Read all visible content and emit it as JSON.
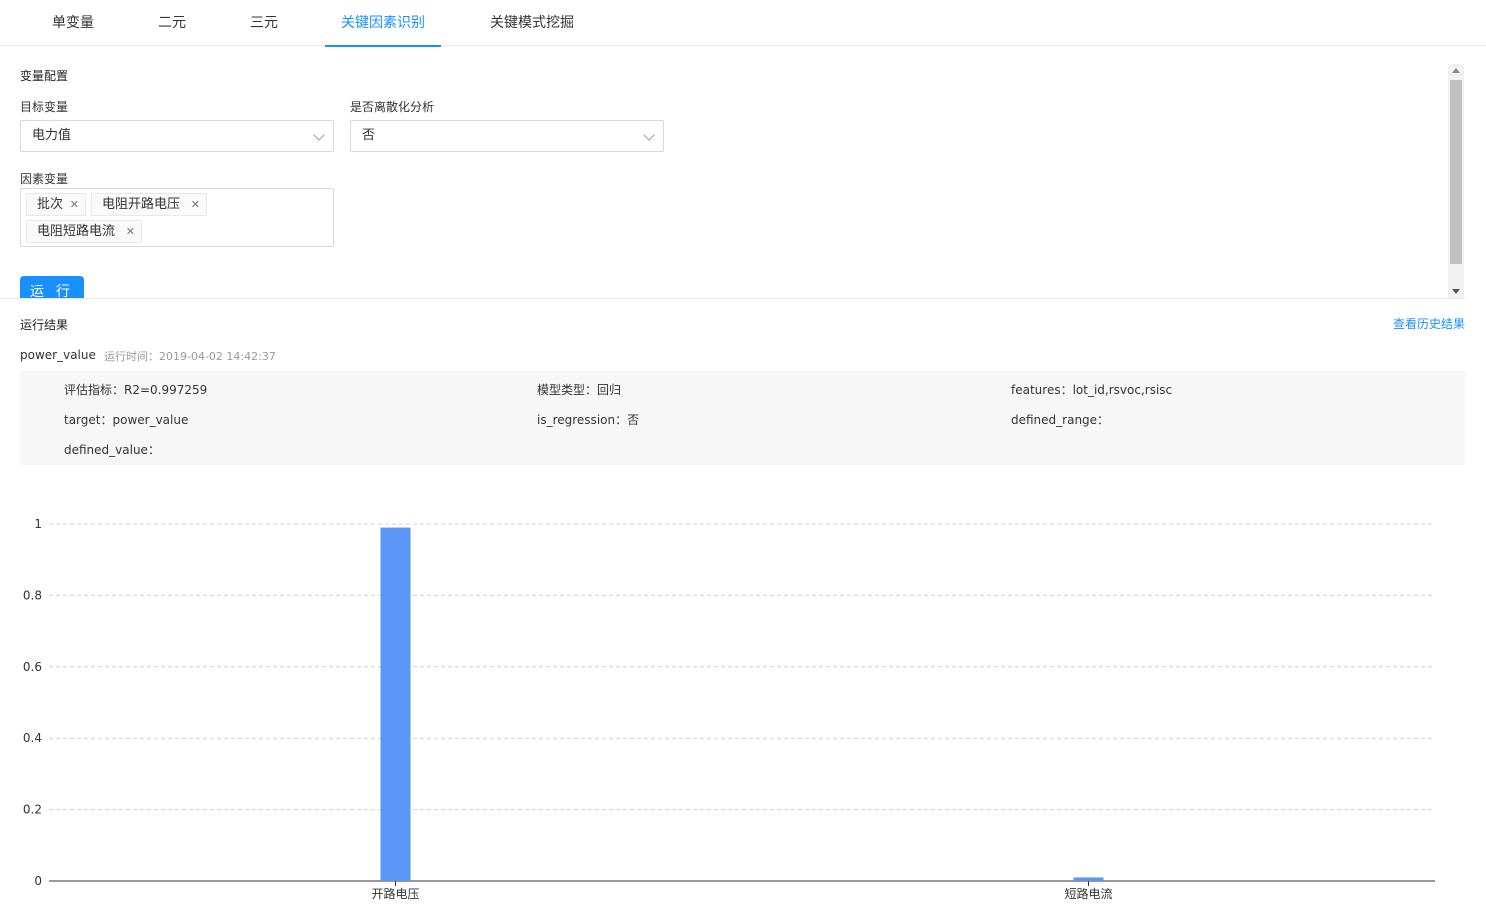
{
  "tabs": [
    {
      "label": "单变量",
      "active": false
    },
    {
      "label": "二元",
      "active": false
    },
    {
      "label": "三元",
      "active": false
    },
    {
      "label": "关键因素识别",
      "active": true
    },
    {
      "label": "关键模式挖掘",
      "active": false
    }
  ],
  "config": {
    "title": "变量配置",
    "target_label": "目标变量",
    "target_value": "电力值",
    "discretize_label": "是否离散化分析",
    "discretize_value": "否",
    "factors_label": "因素变量",
    "factors": [
      "批次",
      "电阻开路电压",
      "电阻短路电流"
    ],
    "run_label": "运 行"
  },
  "result": {
    "title": "运行结果",
    "history_link": "查看历史结果",
    "target_name": "power_value",
    "run_time_label": "运行时间：",
    "run_time_value": "2019-04-02 14:42:37",
    "metrics": [
      "评估指标：R2=0.997259",
      "模型类型：回归",
      "features：lot_id,rsvoc,rsisc",
      "target：power_value",
      "is_regression：否",
      "defined_range：",
      "defined_value："
    ]
  },
  "colors": {
    "accent": "#1890ff",
    "bar": "#5b96f7"
  },
  "chart_data": {
    "type": "bar",
    "categories": [
      "开路电压",
      "短路电流"
    ],
    "values": [
      0.99,
      0.01
    ],
    "ylim": [
      0,
      1
    ],
    "yticks": [
      "0",
      "0.2",
      "0.4",
      "0.6",
      "0.8",
      "1"
    ],
    "grid": true
  }
}
